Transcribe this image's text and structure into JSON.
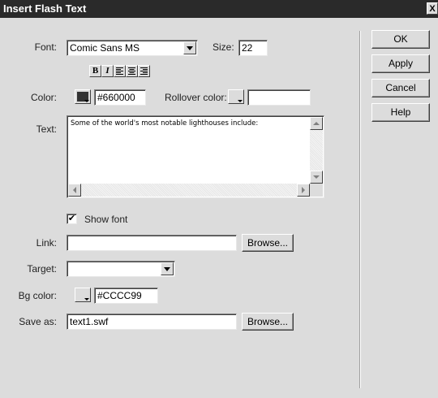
{
  "window": {
    "title": "Insert Flash Text",
    "close_glyph": "X"
  },
  "font": {
    "label": "Font:",
    "value": "Comic Sans MS"
  },
  "size": {
    "label": "Size:",
    "value": "22"
  },
  "format": {
    "bold": "B",
    "italic": "I"
  },
  "color": {
    "label": "Color:",
    "value": "#660000",
    "swatch": "#333333"
  },
  "rollover": {
    "label": "Rollover color:",
    "value": ""
  },
  "text": {
    "label": "Text:",
    "value": "Some of the world's most notable lighthouses include:"
  },
  "show_font": {
    "label": "Show font",
    "checked": true,
    "mark": "✔"
  },
  "link": {
    "label": "Link:",
    "value": "",
    "browse": "Browse..."
  },
  "target": {
    "label": "Target:",
    "value": ""
  },
  "bg_color": {
    "label": "Bg color:",
    "value": "#CCCC99"
  },
  "save_as": {
    "label": "Save as:",
    "value": "text1.swf",
    "browse": "Browse..."
  },
  "buttons": {
    "ok": "OK",
    "apply": "Apply",
    "cancel": "Cancel",
    "help": "Help"
  }
}
